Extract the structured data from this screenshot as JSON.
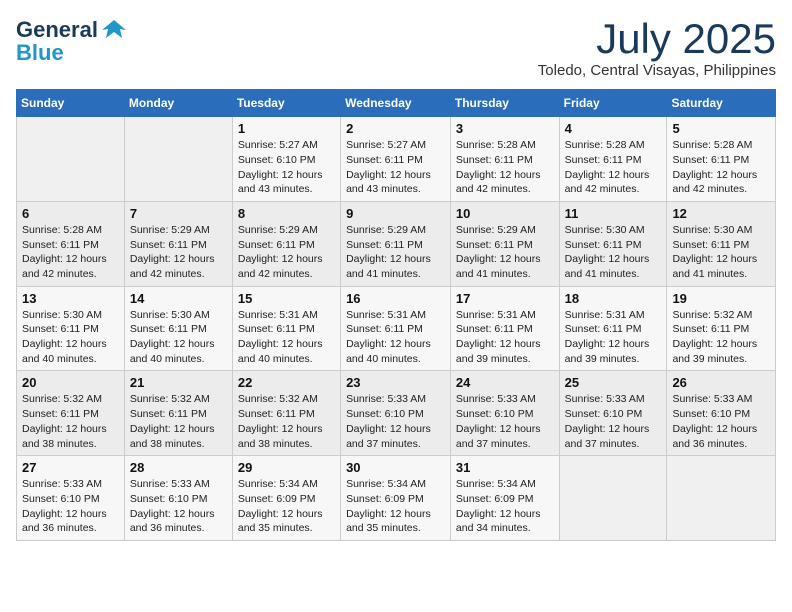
{
  "header": {
    "logo_line1": "General",
    "logo_line2": "Blue",
    "month": "July 2025",
    "location": "Toledo, Central Visayas, Philippines"
  },
  "weekdays": [
    "Sunday",
    "Monday",
    "Tuesday",
    "Wednesday",
    "Thursday",
    "Friday",
    "Saturday"
  ],
  "weeks": [
    [
      {
        "day": "",
        "sunrise": "",
        "sunset": "",
        "daylight": ""
      },
      {
        "day": "",
        "sunrise": "",
        "sunset": "",
        "daylight": ""
      },
      {
        "day": "1",
        "sunrise": "Sunrise: 5:27 AM",
        "sunset": "Sunset: 6:10 PM",
        "daylight": "Daylight: 12 hours and 43 minutes."
      },
      {
        "day": "2",
        "sunrise": "Sunrise: 5:27 AM",
        "sunset": "Sunset: 6:11 PM",
        "daylight": "Daylight: 12 hours and 43 minutes."
      },
      {
        "day": "3",
        "sunrise": "Sunrise: 5:28 AM",
        "sunset": "Sunset: 6:11 PM",
        "daylight": "Daylight: 12 hours and 42 minutes."
      },
      {
        "day": "4",
        "sunrise": "Sunrise: 5:28 AM",
        "sunset": "Sunset: 6:11 PM",
        "daylight": "Daylight: 12 hours and 42 minutes."
      },
      {
        "day": "5",
        "sunrise": "Sunrise: 5:28 AM",
        "sunset": "Sunset: 6:11 PM",
        "daylight": "Daylight: 12 hours and 42 minutes."
      }
    ],
    [
      {
        "day": "6",
        "sunrise": "Sunrise: 5:28 AM",
        "sunset": "Sunset: 6:11 PM",
        "daylight": "Daylight: 12 hours and 42 minutes."
      },
      {
        "day": "7",
        "sunrise": "Sunrise: 5:29 AM",
        "sunset": "Sunset: 6:11 PM",
        "daylight": "Daylight: 12 hours and 42 minutes."
      },
      {
        "day": "8",
        "sunrise": "Sunrise: 5:29 AM",
        "sunset": "Sunset: 6:11 PM",
        "daylight": "Daylight: 12 hours and 42 minutes."
      },
      {
        "day": "9",
        "sunrise": "Sunrise: 5:29 AM",
        "sunset": "Sunset: 6:11 PM",
        "daylight": "Daylight: 12 hours and 41 minutes."
      },
      {
        "day": "10",
        "sunrise": "Sunrise: 5:29 AM",
        "sunset": "Sunset: 6:11 PM",
        "daylight": "Daylight: 12 hours and 41 minutes."
      },
      {
        "day": "11",
        "sunrise": "Sunrise: 5:30 AM",
        "sunset": "Sunset: 6:11 PM",
        "daylight": "Daylight: 12 hours and 41 minutes."
      },
      {
        "day": "12",
        "sunrise": "Sunrise: 5:30 AM",
        "sunset": "Sunset: 6:11 PM",
        "daylight": "Daylight: 12 hours and 41 minutes."
      }
    ],
    [
      {
        "day": "13",
        "sunrise": "Sunrise: 5:30 AM",
        "sunset": "Sunset: 6:11 PM",
        "daylight": "Daylight: 12 hours and 40 minutes."
      },
      {
        "day": "14",
        "sunrise": "Sunrise: 5:30 AM",
        "sunset": "Sunset: 6:11 PM",
        "daylight": "Daylight: 12 hours and 40 minutes."
      },
      {
        "day": "15",
        "sunrise": "Sunrise: 5:31 AM",
        "sunset": "Sunset: 6:11 PM",
        "daylight": "Daylight: 12 hours and 40 minutes."
      },
      {
        "day": "16",
        "sunrise": "Sunrise: 5:31 AM",
        "sunset": "Sunset: 6:11 PM",
        "daylight": "Daylight: 12 hours and 40 minutes."
      },
      {
        "day": "17",
        "sunrise": "Sunrise: 5:31 AM",
        "sunset": "Sunset: 6:11 PM",
        "daylight": "Daylight: 12 hours and 39 minutes."
      },
      {
        "day": "18",
        "sunrise": "Sunrise: 5:31 AM",
        "sunset": "Sunset: 6:11 PM",
        "daylight": "Daylight: 12 hours and 39 minutes."
      },
      {
        "day": "19",
        "sunrise": "Sunrise: 5:32 AM",
        "sunset": "Sunset: 6:11 PM",
        "daylight": "Daylight: 12 hours and 39 minutes."
      }
    ],
    [
      {
        "day": "20",
        "sunrise": "Sunrise: 5:32 AM",
        "sunset": "Sunset: 6:11 PM",
        "daylight": "Daylight: 12 hours and 38 minutes."
      },
      {
        "day": "21",
        "sunrise": "Sunrise: 5:32 AM",
        "sunset": "Sunset: 6:11 PM",
        "daylight": "Daylight: 12 hours and 38 minutes."
      },
      {
        "day": "22",
        "sunrise": "Sunrise: 5:32 AM",
        "sunset": "Sunset: 6:11 PM",
        "daylight": "Daylight: 12 hours and 38 minutes."
      },
      {
        "day": "23",
        "sunrise": "Sunrise: 5:33 AM",
        "sunset": "Sunset: 6:10 PM",
        "daylight": "Daylight: 12 hours and 37 minutes."
      },
      {
        "day": "24",
        "sunrise": "Sunrise: 5:33 AM",
        "sunset": "Sunset: 6:10 PM",
        "daylight": "Daylight: 12 hours and 37 minutes."
      },
      {
        "day": "25",
        "sunrise": "Sunrise: 5:33 AM",
        "sunset": "Sunset: 6:10 PM",
        "daylight": "Daylight: 12 hours and 37 minutes."
      },
      {
        "day": "26",
        "sunrise": "Sunrise: 5:33 AM",
        "sunset": "Sunset: 6:10 PM",
        "daylight": "Daylight: 12 hours and 36 minutes."
      }
    ],
    [
      {
        "day": "27",
        "sunrise": "Sunrise: 5:33 AM",
        "sunset": "Sunset: 6:10 PM",
        "daylight": "Daylight: 12 hours and 36 minutes."
      },
      {
        "day": "28",
        "sunrise": "Sunrise: 5:33 AM",
        "sunset": "Sunset: 6:10 PM",
        "daylight": "Daylight: 12 hours and 36 minutes."
      },
      {
        "day": "29",
        "sunrise": "Sunrise: 5:34 AM",
        "sunset": "Sunset: 6:09 PM",
        "daylight": "Daylight: 12 hours and 35 minutes."
      },
      {
        "day": "30",
        "sunrise": "Sunrise: 5:34 AM",
        "sunset": "Sunset: 6:09 PM",
        "daylight": "Daylight: 12 hours and 35 minutes."
      },
      {
        "day": "31",
        "sunrise": "Sunrise: 5:34 AM",
        "sunset": "Sunset: 6:09 PM",
        "daylight": "Daylight: 12 hours and 34 minutes."
      },
      {
        "day": "",
        "sunrise": "",
        "sunset": "",
        "daylight": ""
      },
      {
        "day": "",
        "sunrise": "",
        "sunset": "",
        "daylight": ""
      }
    ]
  ]
}
